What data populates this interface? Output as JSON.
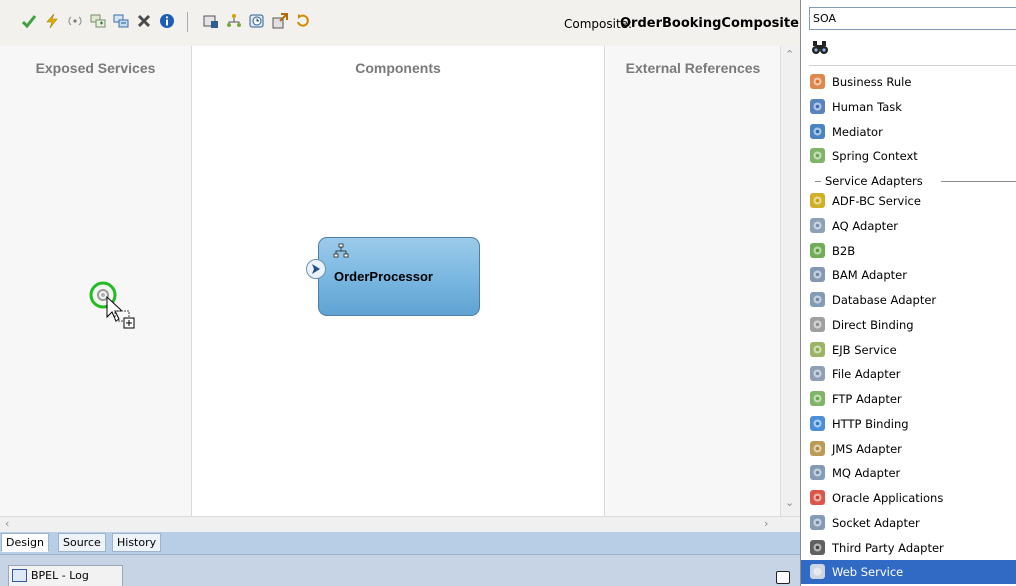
{
  "toolbar": {
    "composite_label": "Composite:",
    "composite_name": "OrderBookingComposite",
    "buttons": [
      {
        "icon": "validate-checkmark-icon",
        "color": "#3ca03c"
      },
      {
        "icon": "lightning-icon",
        "color": "#c59a00"
      },
      {
        "icon": "broadcast-icon",
        "color": "#8a8a8a"
      },
      {
        "icon": "add-wire-icon",
        "color": "#5a7c3a"
      },
      {
        "icon": "layout-icon",
        "color": "#3a6ea5"
      },
      {
        "icon": "delete-icon",
        "color": "#555555"
      },
      {
        "icon": "info-icon",
        "color": "#1d5db5"
      },
      {
        "icon": "test-icon",
        "color": "#2f5f8f"
      },
      {
        "icon": "tree-icon",
        "color": "#7aa83d"
      },
      {
        "icon": "clock-icon",
        "color": "#2f5f8f"
      },
      {
        "icon": "deploy-icon",
        "color": "#b36b00"
      },
      {
        "icon": "refresh-icon",
        "color": "#d28b00"
      }
    ]
  },
  "canvas": {
    "lanes": {
      "exposed": "Exposed Services",
      "components": "Components",
      "external": "External References"
    },
    "component": {
      "name": "OrderProcessor"
    }
  },
  "editor_tabs": {
    "design": "Design",
    "source": "Source",
    "history": "History"
  },
  "log": {
    "tab_label": "BPEL - Log"
  },
  "palette": {
    "selected_page": "SOA",
    "section_header": "Service Adapters",
    "items_above": [
      {
        "label": "Business Rule",
        "icon": "business-rule-icon",
        "color": "#d9732e"
      },
      {
        "label": "Human Task",
        "icon": "human-task-icon",
        "color": "#3b6db3"
      },
      {
        "label": "Mediator",
        "icon": "mediator-icon",
        "color": "#2a6db5"
      },
      {
        "label": "Spring Context",
        "icon": "spring-context-icon",
        "color": "#6aa84f"
      }
    ],
    "items_below": [
      {
        "label": "ADF-BC Service",
        "icon": "adf-bc-service-icon",
        "color": "#c8a200"
      },
      {
        "label": "AQ Adapter",
        "icon": "aq-adapter-icon",
        "color": "#7a8fa8"
      },
      {
        "label": "B2B",
        "icon": "b2b-icon",
        "color": "#5a9e3a"
      },
      {
        "label": "BAM Adapter",
        "icon": "bam-adapter-icon",
        "color": "#6e86a6"
      },
      {
        "label": "Database Adapter",
        "icon": "database-adapter-icon",
        "color": "#6f8aa8"
      },
      {
        "label": "Direct Binding",
        "icon": "direct-binding-icon",
        "color": "#8f8f8f"
      },
      {
        "label": "EJB Service",
        "icon": "ejb-service-icon",
        "color": "#8aa64a"
      },
      {
        "label": "File Adapter",
        "icon": "file-adapter-icon",
        "color": "#7a8fa8"
      },
      {
        "label": "FTP Adapter",
        "icon": "ftp-adapter-icon",
        "color": "#6aa84f"
      },
      {
        "label": "HTTP Binding",
        "icon": "http-binding-icon",
        "color": "#2c7bd1"
      },
      {
        "label": "JMS Adapter",
        "icon": "jms-adapter-icon",
        "color": "#b08a3a"
      },
      {
        "label": "MQ Adapter",
        "icon": "mq-adapter-icon",
        "color": "#6f8aa8"
      },
      {
        "label": "Oracle Applications",
        "icon": "oracle-applications-icon",
        "color": "#d23a2a"
      },
      {
        "label": "Socket Adapter",
        "icon": "socket-adapter-icon",
        "color": "#6f8aa8"
      },
      {
        "label": "Third Party Adapter",
        "icon": "third-party-adapter-icon",
        "color": "#444444"
      },
      {
        "label": "Web Service",
        "icon": "web-service-icon",
        "color": "#e8e8e8",
        "selected": true
      }
    ]
  },
  "colors": {
    "selection": "#316ac5",
    "component_fill": "#78b6e0",
    "drag_highlight": "#22bb22"
  }
}
